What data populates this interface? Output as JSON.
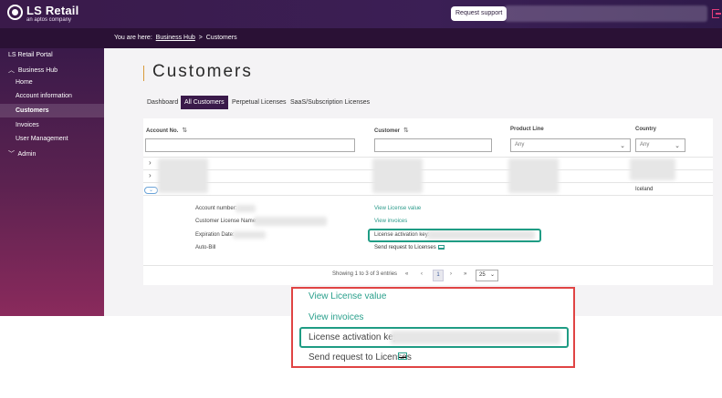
{
  "header": {
    "brand": "LS Retail",
    "brand_sub": "an aptos company",
    "support_button": "Request support"
  },
  "breadcrumb": {
    "prefix": "You are here:",
    "link": "Business Hub",
    "separator": ">",
    "current": "Customers"
  },
  "sidebar": {
    "portal": "LS Retail Portal",
    "group": "Business Hub",
    "items": [
      "Home",
      "Account information",
      "Customers",
      "Invoices",
      "User Management"
    ],
    "admin": "Admin"
  },
  "page": {
    "title": "Customers"
  },
  "tabs": [
    "Dashboard",
    "All Customers",
    "Perpetual Licenses",
    "SaaS/Subscription Licenses"
  ],
  "table": {
    "columns": [
      "Account No.",
      "Customer",
      "Product Line",
      "Country"
    ],
    "product_line_filter": "Any",
    "country_filter": "Any",
    "country_value": "Iceland"
  },
  "detail": {
    "account_number_label": "Account number:",
    "license_name_label": "Customer License Name:",
    "expiration_label": "Expiration Date:",
    "autobill_label": "Auto-Bill",
    "view_license_value": "View License value",
    "view_invoices": "View invoices",
    "activation_key_label": "License activation key:",
    "send_request": "Send request to Licenses"
  },
  "pager": {
    "summary": "Showing 1 to 3 of 3 entries",
    "current_page": "1",
    "page_size": "25"
  },
  "zoom": {
    "view_license_value": "View License value",
    "view_invoices": "View invoices",
    "activation_key_label": "License activation key:",
    "send_request": "Send request to Licenses"
  }
}
